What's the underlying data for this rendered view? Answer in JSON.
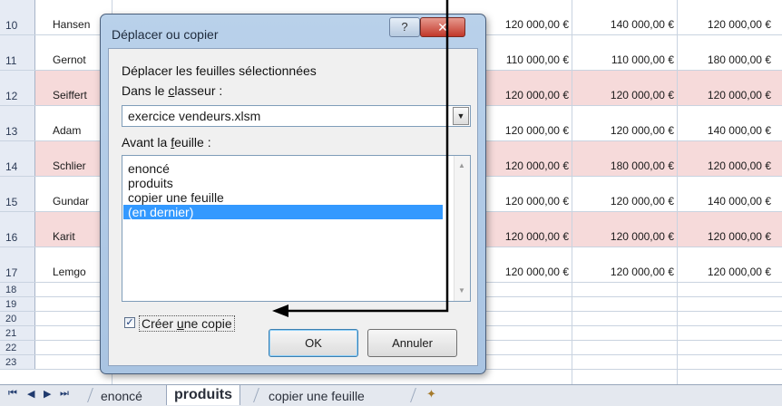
{
  "sheet": {
    "rows": [
      {
        "num": "10",
        "name": "Hansen",
        "c3": "120 000,00 €",
        "c4": "140 000,00 €",
        "c5": "120 000,00 €"
      },
      {
        "num": "11",
        "name": "Gernot",
        "c3": "110 000,00 €",
        "c4": "110 000,00 €",
        "c5": "180 000,00 €"
      },
      {
        "num": "12",
        "name": "Seiffert",
        "c3": "120 000,00 €",
        "c4": "120 000,00 €",
        "c5": "120 000,00 €"
      },
      {
        "num": "13",
        "name": "Adam",
        "c3": "120 000,00 €",
        "c4": "120 000,00 €",
        "c5": "140 000,00 €"
      },
      {
        "num": "14",
        "name": "Schlier",
        "c3": "120 000,00 €",
        "c4": "180 000,00 €",
        "c5": "120 000,00 €"
      },
      {
        "num": "15",
        "name": "Gundar",
        "c3": "120 000,00 €",
        "c4": "120 000,00 €",
        "c5": "140 000,00 €"
      },
      {
        "num": "16",
        "name": "Karit",
        "c3": "120 000,00 €",
        "c4": "120 000,00 €",
        "c5": "120 000,00 €"
      },
      {
        "num": "17",
        "name": "Lemgo",
        "c3": "120 000,00 €",
        "c4": "120 000,00 €",
        "c5": "120 000,00 €"
      }
    ],
    "empty_rows": [
      "18",
      "19",
      "20",
      "21",
      "22",
      "23"
    ]
  },
  "tabs": {
    "nav": [
      "⏮",
      "◀",
      "▶",
      "⏭"
    ],
    "items": [
      "enoncé",
      "produits",
      "copier une feuille"
    ],
    "active": "produits"
  },
  "dialog": {
    "title": "Déplacer ou copier",
    "help_label": "?",
    "close_label": "✕",
    "move_label": "Déplacer les feuilles sélectionnées",
    "workbook_label_pre": "Dans le ",
    "workbook_label_u": "c",
    "workbook_label_post": "lasseur :",
    "workbook_value": "exercice vendeurs.xlsm",
    "before_label_pre": "Avant la ",
    "before_label_u": "f",
    "before_label_post": "euille :",
    "sheets": [
      "enoncé",
      "produits",
      "copier une feuille",
      "(en dernier)"
    ],
    "selected_sheet": "(en dernier)",
    "copy_checked": true,
    "copy_label_pre": "Créer ",
    "copy_label_u": "u",
    "copy_label_post": "ne copie",
    "ok_label": "OK",
    "cancel_label": "Annuler"
  },
  "colors": {
    "row_highlight": "#f6dada",
    "dialog_frame": "#b9d1ea",
    "selection": "#3399ff",
    "close_button": "#c2382a"
  }
}
